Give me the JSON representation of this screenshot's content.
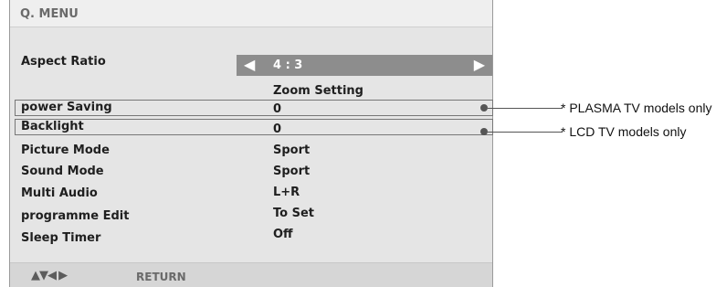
{
  "menu": {
    "title": "Q. MENU",
    "aspect_ratio": {
      "label": "Aspect Ratio",
      "value": "4 : 3",
      "left_arrow": "◀",
      "right_arrow": "▶"
    },
    "zoom_setting": "Zoom Setting",
    "rows": [
      {
        "label": "power Saving",
        "value": "0"
      },
      {
        "label": "Backlight",
        "value": "0"
      },
      {
        "label": "Picture Mode",
        "value": "Sport"
      },
      {
        "label": "Sound Mode",
        "value": "Sport"
      },
      {
        "label": "Multi Audio",
        "value": "L+R"
      },
      {
        "label": "programme Edit",
        "value": "To Set"
      },
      {
        "label": "Sleep Timer",
        "value": "Off"
      }
    ]
  },
  "footer": {
    "arrows": "▲▼◀ ▶",
    "return_label": "RETURN"
  },
  "notes": {
    "plasma": "* PLASMA TV models only",
    "lcd": "* LCD TV models only"
  }
}
